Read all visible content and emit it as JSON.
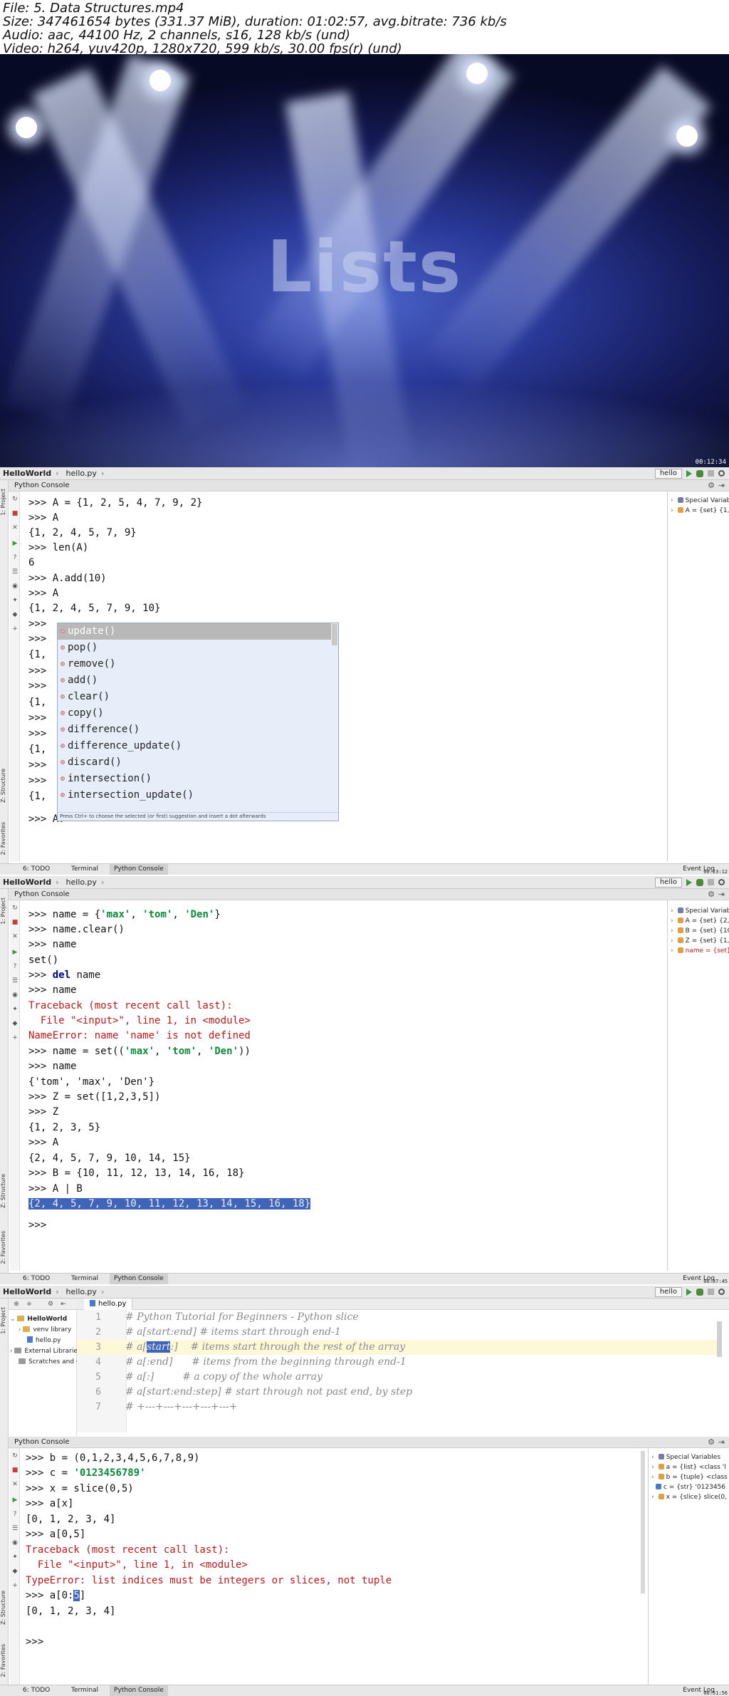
{
  "file_info": {
    "line1": "File: 5. Data Structures.mp4",
    "line2": "Size: 347461654 bytes (331.37 MiB), duration: 01:02:57, avg.bitrate: 736 kb/s",
    "line3": "Audio: aac, 44100 Hz, 2 channels, s16, 128 kb/s (und)",
    "line4": "Video: h264, yuv420p, 1280x720, 599 kb/s, 30.00 fps(r) (und)"
  },
  "video": {
    "title": "Lists",
    "timecode": "00:12:34"
  },
  "nav": {
    "project": "HelloWorld",
    "file": "hello.py",
    "run_config": "hello"
  },
  "left_labels": {
    "project": "1: Project",
    "structure": "Z: Structure",
    "favorites": "2: Favorites"
  },
  "tabs": {
    "todo": "6: TODO",
    "terminal": "Terminal",
    "python_console": "Python Console",
    "event_log": "Event Log"
  },
  "console_title": "Python Console",
  "panel1": {
    "lines": [
      ">>> A = {1, 2, 5, 4, 7, 9, 2}",
      ">>> A",
      "{1, 2, 4, 5, 7, 9}",
      ">>> len(A)",
      "6",
      ">>> A.add(10)",
      ">>> A",
      "{1, 2, 4, 5, 7, 9, 10}",
      ">>> ",
      ">>> ",
      "{1, ",
      ">>> ",
      ">>> ",
      "{1, ",
      ">>> ",
      ">>> ",
      "{1, ",
      ">>> ",
      ">>> ",
      "{1, "
    ],
    "prompt_line": ">>> A.",
    "autocomplete": [
      "update()",
      "pop()",
      "remove()",
      "add()",
      "clear()",
      "copy()",
      "difference()",
      "difference_update()",
      "discard()",
      "intersection()",
      "intersection_update()"
    ],
    "autocomplete_footer": "Press Ctrl+ to choose the selected (or first) suggestion and insert a dot afterwards",
    "variables": [
      {
        "label": "Special Variables"
      },
      {
        "label": "A = {set} {1, 2,"
      }
    ],
    "timestamp": "00:23:12"
  },
  "panel2": {
    "variables": [
      {
        "label": "Special Variables"
      },
      {
        "label": "A = {set} {2, 4,"
      },
      {
        "label": "B = {set} {10, 1"
      },
      {
        "label": "Z = {set} {1, 2,"
      },
      {
        "label": "name = {set}"
      }
    ],
    "timestamp": "00:37:45"
  },
  "panel3": {
    "editor_tab": "hello.py",
    "editor_lines": [
      {
        "n": "1",
        "text": "# Python Tutorial for Beginners - Python slice"
      },
      {
        "n": "2",
        "text": "# a[start:end] # items start through end-1"
      },
      {
        "n": "3",
        "text": "# a[start:]    # items start through the rest of the array"
      },
      {
        "n": "4",
        "text": "# a[:end]      # items from the beginning through end-1"
      },
      {
        "n": "5",
        "text": "# a[:]         # a copy of the whole array"
      },
      {
        "n": "6",
        "text": "# a[start:end:step] # start through not past end, by step"
      },
      {
        "n": "7",
        "text": "# +---+---+---+---+---+"
      }
    ],
    "tree": [
      {
        "label": "HelloWorld"
      },
      {
        "label": "venv library"
      },
      {
        "label": "hello.py"
      },
      {
        "label": "External Libraries"
      },
      {
        "label": "Scratches and Consoles"
      }
    ],
    "variables": [
      {
        "label": "Special Variables"
      },
      {
        "label": "a = {list} <class 'l"
      },
      {
        "label": "b = {tuple} <class"
      },
      {
        "label": "c = {str} '0123456"
      },
      {
        "label": "x = {slice} slice(0,"
      }
    ],
    "timestamp": "00:51:56"
  },
  "colors": {
    "string": "#0a8a3a",
    "keyword": "#000080",
    "error": "#c0181a",
    "selection": "#3f64b8",
    "stage_center": "#4c63c8"
  }
}
